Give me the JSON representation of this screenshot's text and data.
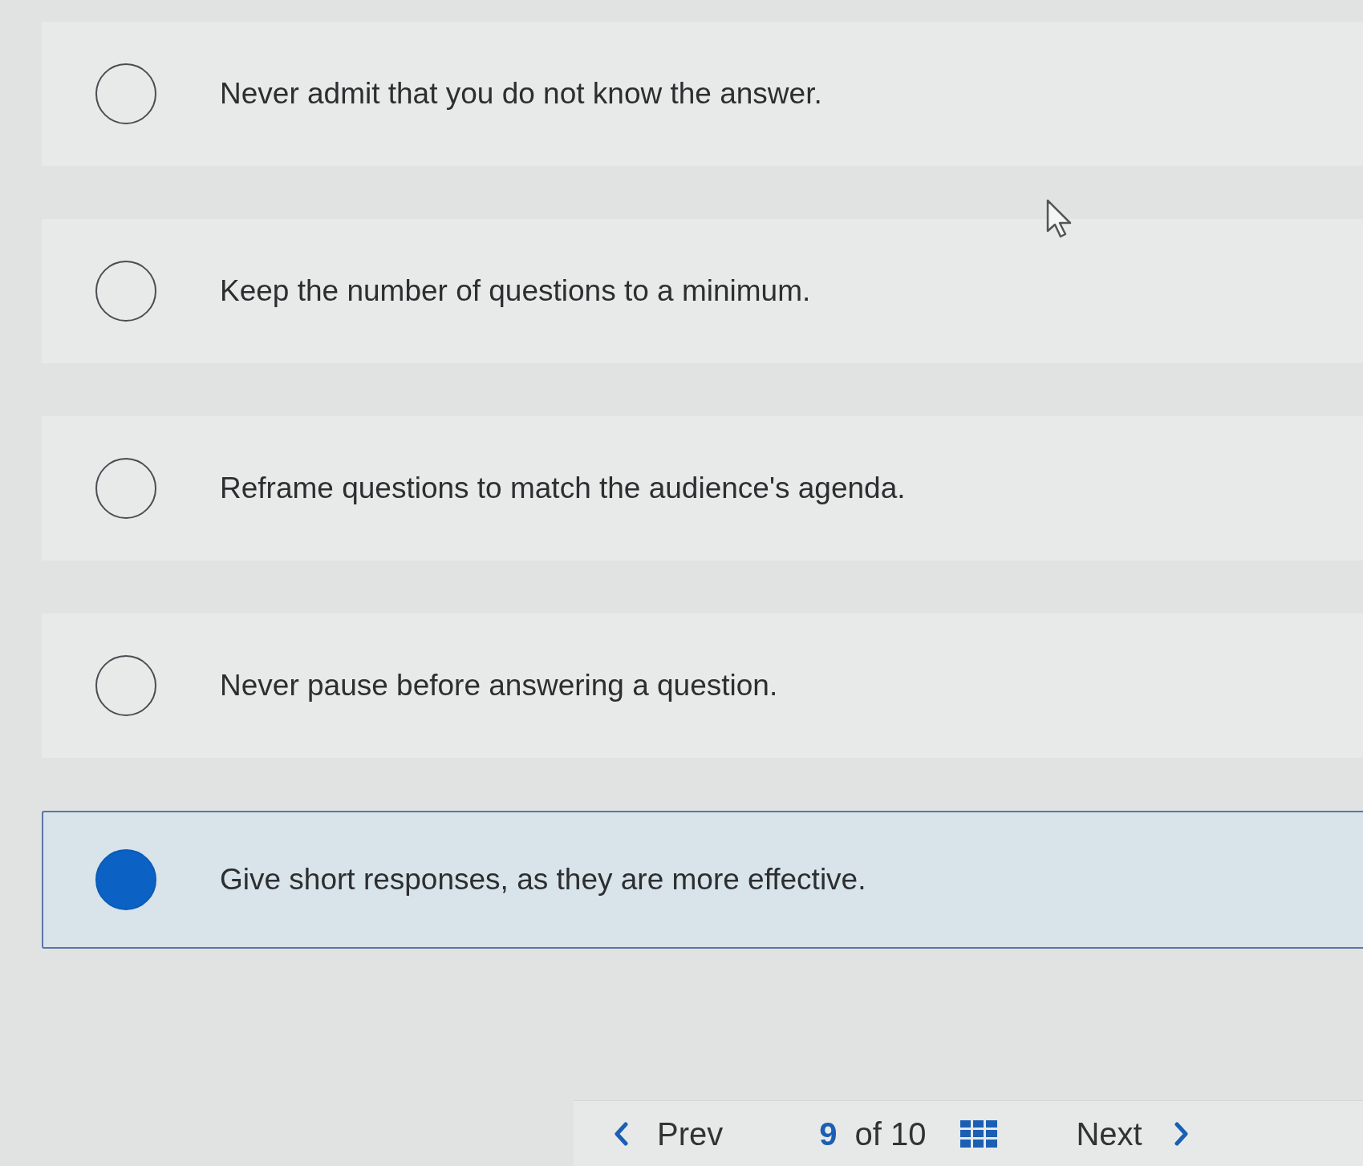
{
  "options": [
    {
      "text": "Never admit that you do not know the answer.",
      "selected": false
    },
    {
      "text": "Keep the number of questions to a minimum.",
      "selected": false
    },
    {
      "text": "Reframe questions to match the audience's agenda.",
      "selected": false
    },
    {
      "text": "Never pause before answering a question.",
      "selected": false
    },
    {
      "text": "Give short responses, as they are more effective.",
      "selected": true
    }
  ],
  "pagination": {
    "prev": "Prev",
    "current": "9",
    "total": "of 10",
    "next": "Next"
  }
}
